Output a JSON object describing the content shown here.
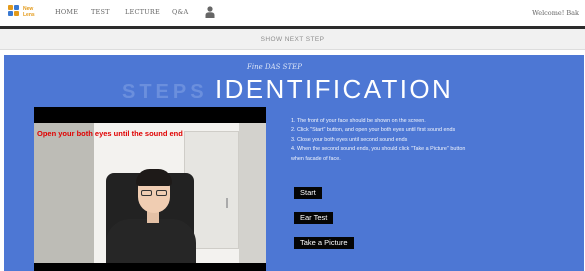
{
  "nav": {
    "logo_line1": "New",
    "logo_line2": "Lens",
    "items": [
      "HOME",
      "TEST",
      "LECTURE",
      "Q&A"
    ],
    "welcome": "Welcome! Bak"
  },
  "next_step_label": "SHOW NEXT STEP",
  "panel": {
    "background_word": "STEPS",
    "step_tag": "Fine DAS STEP",
    "title": "IDENTIFICATION"
  },
  "camera": {
    "overlay_text": "Open your both eyes until the sound end"
  },
  "instructions": [
    "1. The front of your face should be shown on the screen.",
    "2. Click \"Start\" button, and open your both eyes until first sound ends",
    "3. Close your both eyes until second sound ends",
    "4. When the second sound ends, you should click \"Take a Picture\" button",
    "when facade of face."
  ],
  "buttons": {
    "start": "Start",
    "ear_test": "Ear Test",
    "take_picture": "Take a Picture"
  },
  "colors": {
    "panel_bg": "#4d77d4",
    "overlay_text": "#e00000",
    "logo_accent": "#e39a1a"
  }
}
